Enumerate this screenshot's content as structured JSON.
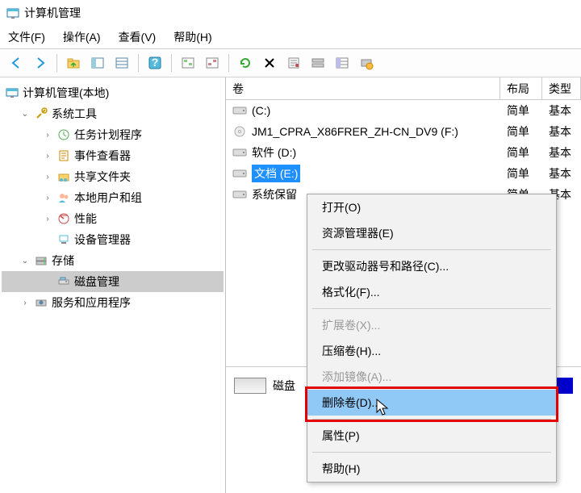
{
  "window": {
    "title": "计算机管理"
  },
  "menubar": {
    "file": "文件(F)",
    "action": "操作(A)",
    "view": "查看(V)",
    "help": "帮助(H)"
  },
  "tree": {
    "root": "计算机管理(本地)",
    "system_tools": "系统工具",
    "task_scheduler": "任务计划程序",
    "event_viewer": "事件查看器",
    "shared_folders": "共享文件夹",
    "local_users": "本地用户和组",
    "performance": "性能",
    "device_manager": "设备管理器",
    "storage": "存储",
    "disk_management": "磁盘管理",
    "services": "服务和应用程序"
  },
  "columns": {
    "volume": "卷",
    "layout": "布局",
    "type": "类型"
  },
  "volumes": [
    {
      "icon": "drive",
      "name": "(C:)",
      "layout": "简单",
      "type": "基本"
    },
    {
      "icon": "cd",
      "name": "JM1_CPRA_X86FRER_ZH-CN_DV9 (F:)",
      "layout": "简单",
      "type": "基本"
    },
    {
      "icon": "drive",
      "name": "软件 (D:)",
      "layout": "简单",
      "type": "基本"
    },
    {
      "icon": "drive",
      "name": "文档 (E:)",
      "layout": "简单",
      "type": "基本",
      "selected": true
    },
    {
      "icon": "drive",
      "name": "系统保留",
      "layout": "简单",
      "type": "基本"
    }
  ],
  "context_menu": {
    "open": "打开(O)",
    "explorer": "资源管理器(E)",
    "change_drive": "更改驱动器号和路径(C)...",
    "format": "格式化(F)...",
    "extend": "扩展卷(X)...",
    "shrink": "压缩卷(H)...",
    "mirror": "添加镜像(A)...",
    "delete": "删除卷(D)...",
    "properties": "属性(P)",
    "help": "帮助(H)"
  },
  "footer": {
    "disk_label": "磁盘"
  }
}
